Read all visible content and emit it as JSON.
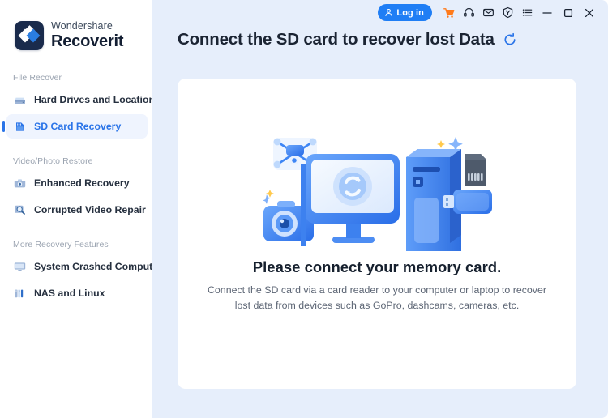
{
  "brand": {
    "top": "Wondershare",
    "bottom": "Recoverit",
    "logo_icon": "recoverit-diamond-logo",
    "logo_bg": "#1a2b4c",
    "accent": "#2a74e8"
  },
  "sidebar": {
    "groups": [
      {
        "label": "File Recover",
        "items": [
          {
            "label": "Hard Drives and Locations",
            "icon": "hard-drive-icon",
            "active": false
          },
          {
            "label": "SD Card Recovery",
            "icon": "sd-card-icon",
            "active": true
          }
        ]
      },
      {
        "label": "Video/Photo Restore",
        "items": [
          {
            "label": "Enhanced Recovery",
            "icon": "camera-icon",
            "active": false
          },
          {
            "label": "Corrupted Video Repair",
            "icon": "video-repair-magnifier-icon",
            "active": false
          }
        ]
      },
      {
        "label": "More Recovery Features",
        "items": [
          {
            "label": "System Crashed Computer",
            "icon": "monitor-icon",
            "active": false
          },
          {
            "label": "NAS and Linux",
            "icon": "nas-server-icon",
            "active": false
          }
        ]
      }
    ]
  },
  "titlebar": {
    "login_label": "Log in",
    "login_icon": "user-person-icon",
    "login_bg": "#1f7ef5",
    "icons": [
      {
        "name": "shopping-cart-icon",
        "color": "#ff7a1a"
      },
      {
        "name": "headset-support-icon",
        "color": "#1b2433"
      },
      {
        "name": "envelope-mail-icon",
        "color": "#1b2433"
      },
      {
        "name": "upgrade-shield-icon",
        "color": "#1b2433"
      },
      {
        "name": "list-menu-icon",
        "color": "#1b2433"
      }
    ],
    "window_controls": [
      {
        "name": "minimize-button",
        "glyph": "minimize"
      },
      {
        "name": "maximize-button",
        "glyph": "maximize"
      },
      {
        "name": "close-button",
        "glyph": "close"
      }
    ]
  },
  "page": {
    "title": "Connect the SD card to recover lost Data",
    "refresh_icon": "refresh-circular-arrow-icon",
    "refresh_color": "#2a74e8"
  },
  "card": {
    "illustration_icon": "sd-card-reader-devices-illustration",
    "illustration_parts": [
      "drone-icon",
      "camera-icon",
      "desktop-monitor-icon",
      "pc-tower-icon",
      "usb-card-reader-icon",
      "sd-card-icon",
      "sparkle-icon"
    ],
    "headline": "Please connect your memory card.",
    "subtext": "Connect the SD card via a card reader to your computer or laptop to recover lost data from devices such as GoPro, dashcams, cameras, etc."
  },
  "theme": {
    "main_bg": "#e6eefb",
    "card_bg": "#ffffff",
    "sidebar_bg": "#ffffff"
  }
}
